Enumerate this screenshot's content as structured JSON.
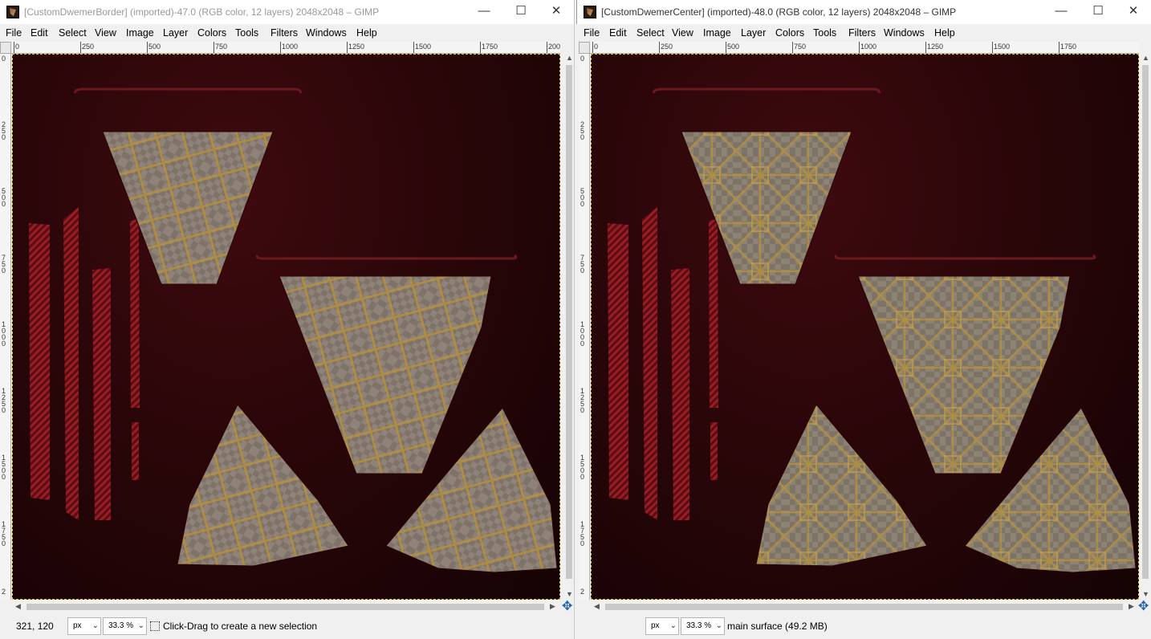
{
  "windows": [
    {
      "id": "left",
      "title": "[CustomDwemerBorder] (imported)-47.0 (RGB color, 12 layers) 2048x2048 – GIMP",
      "menu": [
        "File",
        "Edit",
        "Select",
        "View",
        "Image",
        "Layer",
        "Colors",
        "Tools",
        "Filters",
        "Windows",
        "Help"
      ],
      "ruler_h_labels": [
        "0",
        "250",
        "500",
        "750",
        "1000",
        "1250",
        "1500",
        "1750",
        "200"
      ],
      "ruler_v_labels": [
        "0",
        "250",
        "500",
        "750",
        "1000",
        "1250",
        "1500",
        "1750",
        "2"
      ],
      "status": {
        "coords": "321, 120",
        "unit": "px",
        "zoom": "33.3 %",
        "message": "Click-Drag to create a new selection"
      }
    },
    {
      "id": "right",
      "title": "[CustomDwemerCenter] (imported)-48.0 (RGB color, 12 layers) 2048x2048 – GIMP",
      "menu": [
        "File",
        "Edit",
        "Select",
        "View",
        "Image",
        "Layer",
        "Colors",
        "Tools",
        "Filters",
        "Windows",
        "Help"
      ],
      "ruler_h_labels": [
        "0",
        "250",
        "500",
        "750",
        "1000",
        "1250",
        "1500",
        "1750"
      ],
      "ruler_v_labels": [
        "0",
        "250",
        "500",
        "750",
        "1000",
        "1250",
        "1500",
        "1750",
        "2"
      ],
      "status": {
        "unit": "px",
        "zoom": "33.3 %",
        "message": "main surface  (49.2 MB)"
      }
    }
  ],
  "window_controls": {
    "minimize": "—",
    "maximize": "☐",
    "close": "✕"
  },
  "icons": {
    "navigate": "navigate-icon",
    "app": "gimp-icon"
  },
  "colors": {
    "canvas_dark": "#2a0609",
    "stripe_red": "#8a1a20",
    "selection_border": "#d8c040"
  }
}
